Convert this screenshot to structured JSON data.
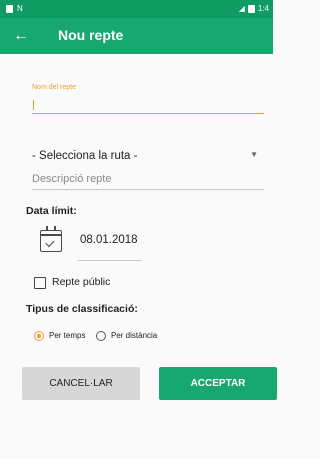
{
  "statusbar": {
    "left_icons": [
      "sim-icon",
      "n-icon"
    ],
    "time": "1:4"
  },
  "toolbar": {
    "back": "←",
    "title": "Nou repte"
  },
  "form": {
    "name_label": "Nom del repte",
    "route_value": "- Selecciona la ruta -",
    "description_placeholder": "Descripció repte",
    "deadline_title": "Data límit:",
    "date_value": "08.01.2018",
    "public_label": "Repte públic",
    "classification_title": "Tipus de classificació:",
    "option_time": "Per temps",
    "option_distance": "Per distància"
  },
  "buttons": {
    "cancel": "CANCEL·LAR",
    "accept": "ACCEPTAR"
  },
  "colors": {
    "primary": "#16a86e",
    "accent": "#f39a3a"
  }
}
